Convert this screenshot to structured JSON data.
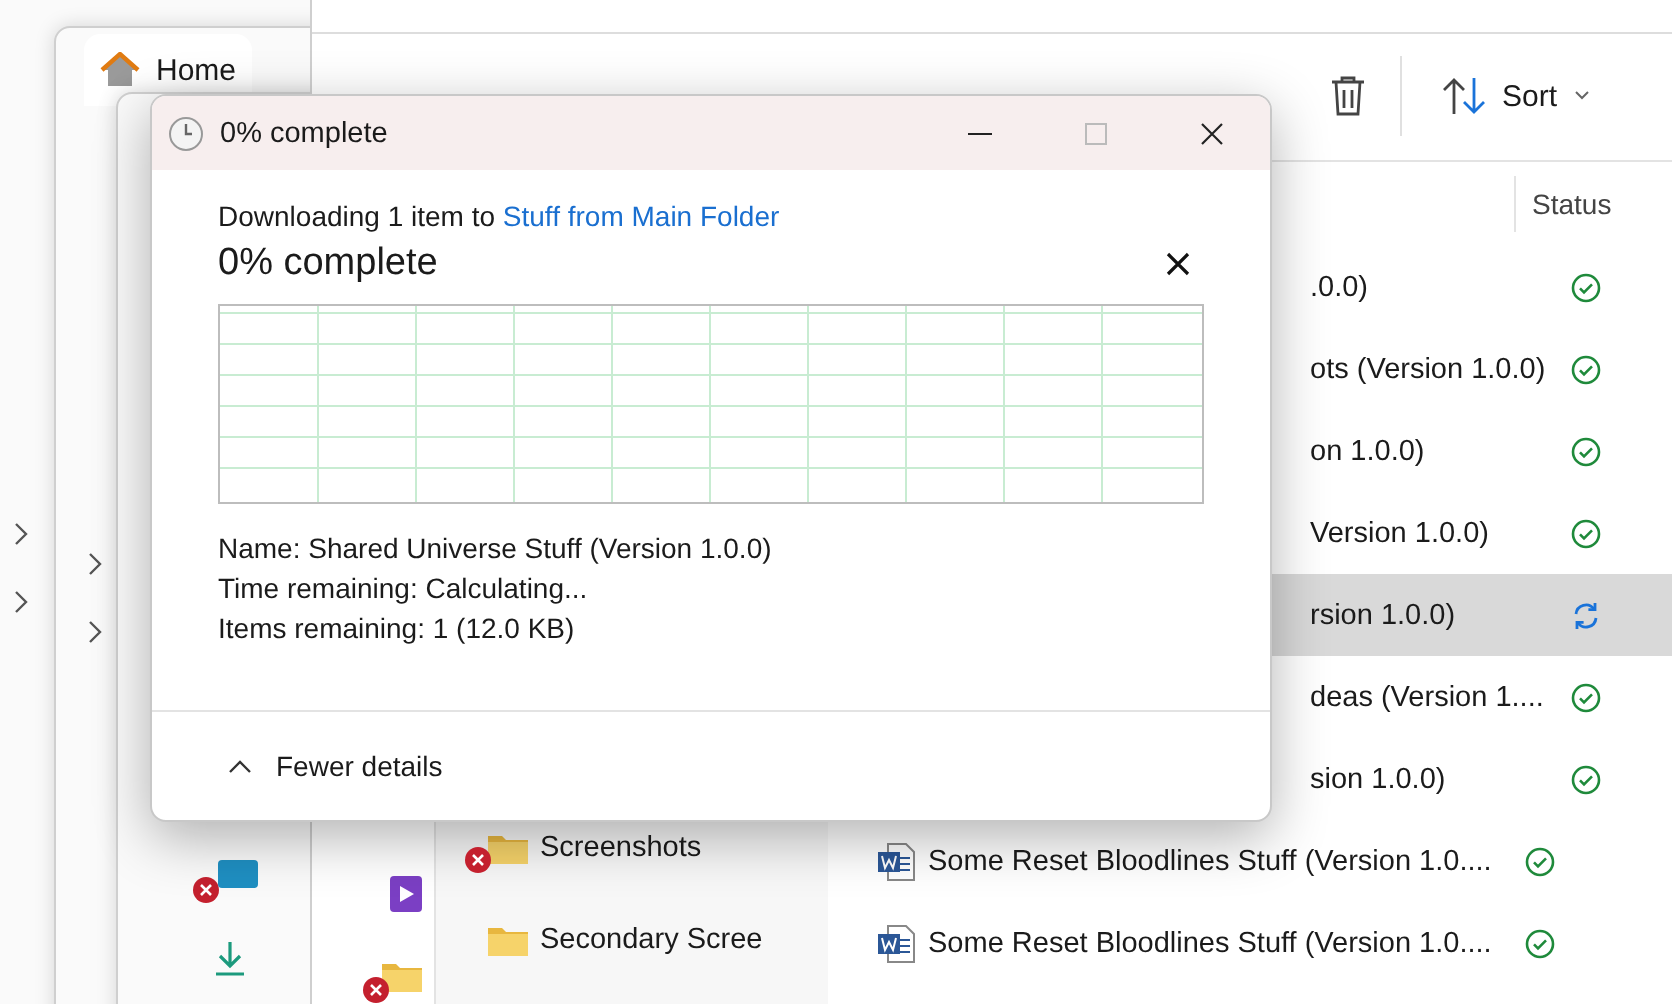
{
  "background_windows": [
    {
      "tab": "Home"
    }
  ],
  "explorer": {
    "toolbar": {
      "sort": "Sort"
    },
    "columns": [
      "Status"
    ],
    "nav_items": [
      {
        "name": "Screenshots",
        "error": true
      },
      {
        "name": "Secondary Scree",
        "error": false
      }
    ],
    "rows": [
      {
        "kind": "partial",
        "name": ".0.0)",
        "syncing": false,
        "selected": false
      },
      {
        "kind": "partial",
        "name": "ots (Version 1.0.0)",
        "syncing": false,
        "selected": false
      },
      {
        "kind": "partial",
        "name": "on 1.0.0)",
        "syncing": false,
        "selected": false
      },
      {
        "kind": "partial",
        "name": "Version 1.0.0)",
        "syncing": false,
        "selected": false
      },
      {
        "kind": "partial",
        "name": "rsion 1.0.0)",
        "syncing": true,
        "selected": true
      },
      {
        "kind": "partial",
        "name": "deas (Version 1....",
        "syncing": false,
        "selected": false
      },
      {
        "kind": "partial",
        "name": "sion 1.0.0)",
        "syncing": false,
        "selected": false
      },
      {
        "kind": "document",
        "name": "Some Reset Bloodlines Stuff (Version 1.0....",
        "syncing": false,
        "selected": false
      },
      {
        "kind": "document",
        "name": "Some Reset Bloodlines Stuff (Version 1.0....",
        "syncing": false,
        "selected": false
      }
    ]
  },
  "dialog": {
    "title": "0% complete",
    "message": "Downloading 1 item to ",
    "destination_link": "Stuff from Main Folder",
    "progress_heading": "0% complete",
    "details": [
      "Name: Shared Universe Stuff (Version 1.0.0)",
      "Time remaining: Calculating...",
      "Items remaining: 1 (12.0 KB)"
    ],
    "toggle": "Fewer details",
    "expanded": true
  }
}
